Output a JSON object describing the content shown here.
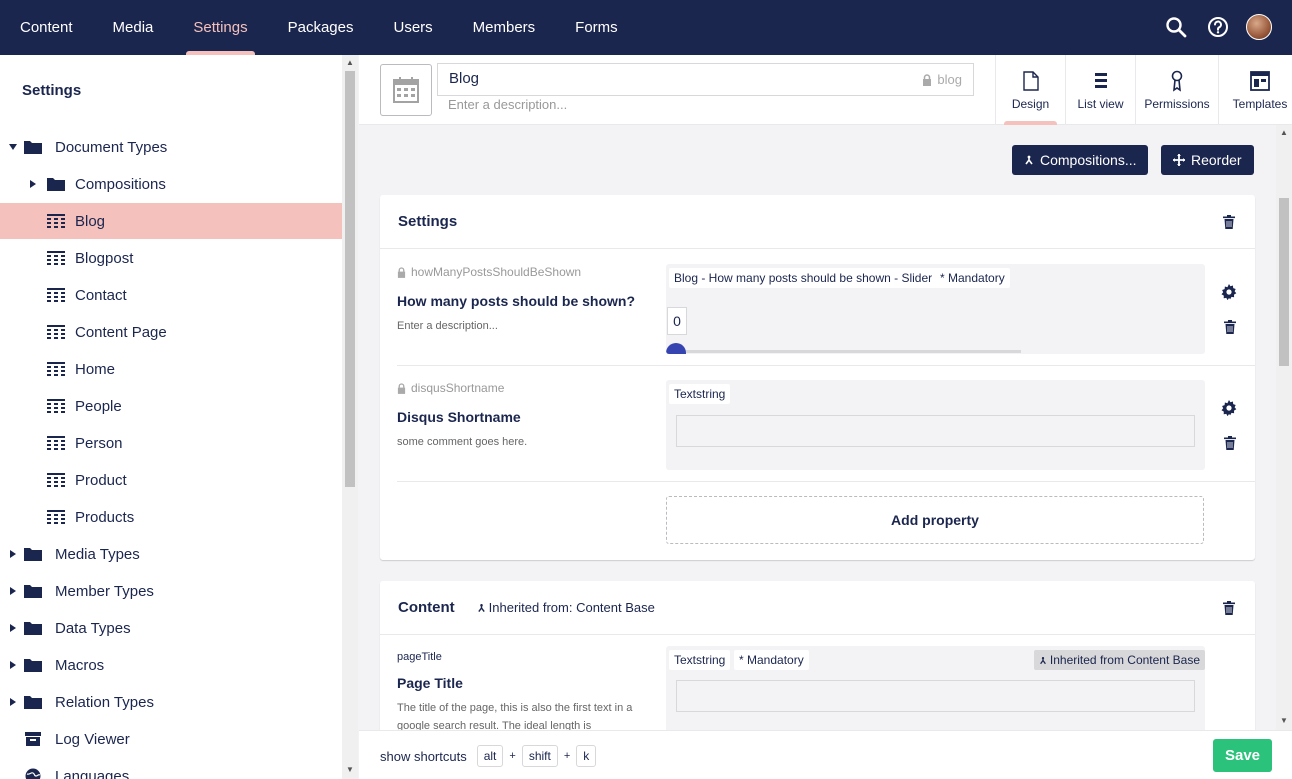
{
  "topnav": {
    "items": [
      {
        "label": "Content"
      },
      {
        "label": "Media"
      },
      {
        "label": "Settings"
      },
      {
        "label": "Packages"
      },
      {
        "label": "Users"
      },
      {
        "label": "Members"
      },
      {
        "label": "Forms"
      }
    ],
    "active": "Settings",
    "icons": [
      "search-icon",
      "help-icon",
      "user-avatar"
    ]
  },
  "sidebar": {
    "title": "Settings",
    "tree": [
      {
        "label": "Document Types",
        "icon": "folder-icon",
        "caret": "down"
      },
      {
        "label": "Compositions",
        "icon": "folder-icon",
        "caret": "right"
      },
      {
        "label": "Blog",
        "icon": "doctype-icon",
        "selected": true
      },
      {
        "label": "Blogpost",
        "icon": "doctype-icon"
      },
      {
        "label": "Contact",
        "icon": "doctype-icon"
      },
      {
        "label": "Content Page",
        "icon": "doctype-icon"
      },
      {
        "label": "Home",
        "icon": "doctype-icon"
      },
      {
        "label": "People",
        "icon": "doctype-icon"
      },
      {
        "label": "Person",
        "icon": "doctype-icon"
      },
      {
        "label": "Product",
        "icon": "doctype-icon"
      },
      {
        "label": "Products",
        "icon": "doctype-icon"
      },
      {
        "label": "Media Types",
        "icon": "folder-icon",
        "caret": "right"
      },
      {
        "label": "Member Types",
        "icon": "folder-icon",
        "caret": "right"
      },
      {
        "label": "Data Types",
        "icon": "folder-icon",
        "caret": "right"
      },
      {
        "label": "Macros",
        "icon": "folder-icon",
        "caret": "right"
      },
      {
        "label": "Relation Types",
        "icon": "folder-icon",
        "caret": "right"
      },
      {
        "label": "Log Viewer",
        "icon": "archive-icon"
      },
      {
        "label": "Languages",
        "icon": "globe-icon"
      }
    ]
  },
  "header": {
    "name": "Blog",
    "alias": "blog",
    "description_placeholder": "Enter a description...",
    "apps": [
      {
        "label": "Design",
        "icon": "document-icon",
        "active": true
      },
      {
        "label": "List view",
        "icon": "list-icon"
      },
      {
        "label": "Permissions",
        "icon": "permissions-icon"
      },
      {
        "label": "Templates",
        "icon": "templates-icon"
      }
    ]
  },
  "toolbar": {
    "compositions_label": "Compositions...",
    "reorder_label": "Reorder"
  },
  "groups": [
    {
      "name": "Settings",
      "properties": [
        {
          "alias": "howManyPostsShouldBeShown",
          "name": "How many posts should be shown?",
          "description": "Enter a description...",
          "editor": "Blog - How many posts should be shown - Slider",
          "mandatory": "* Mandatory",
          "slider_value": "0"
        },
        {
          "alias": "disqusShortname",
          "name": "Disqus Shortname",
          "description": "some comment goes here.",
          "editor": "Textstring"
        }
      ],
      "add_property_label": "Add property"
    },
    {
      "name": "Content",
      "inherited": "Inherited from: Content Base",
      "properties": [
        {
          "alias": "pageTitle",
          "name": "Page Title",
          "description": "The title of the page, this is also the first text in a google search result. The ideal length is",
          "editor": "Textstring",
          "mandatory": "* Mandatory",
          "inherited_tag": "Inherited from Content Base"
        }
      ]
    }
  ],
  "footer": {
    "shortcuts_label": "show shortcuts",
    "keys": [
      "alt",
      "shift",
      "k"
    ],
    "plus": "+",
    "save_label": "Save"
  },
  "colors": {
    "primary": "#1b264f",
    "selected": "#f5c1bc",
    "save": "#2bc37c",
    "background": "#f3f3f5"
  }
}
